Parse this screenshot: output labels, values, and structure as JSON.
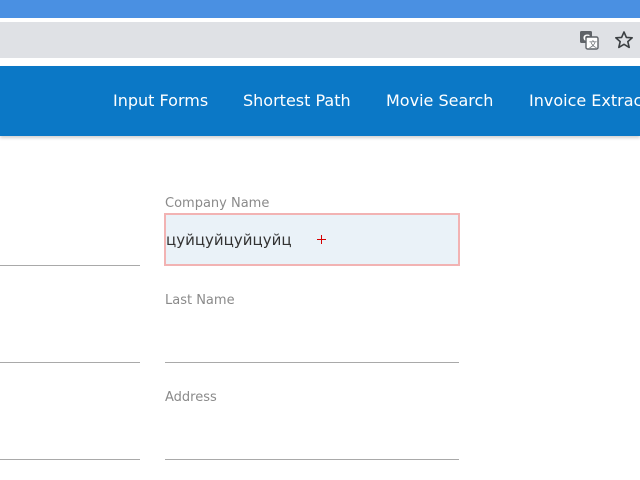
{
  "browser": {
    "translate_icon": "translate-icon",
    "bookmark_icon": "star-icon"
  },
  "nav": {
    "links": [
      {
        "label": "Input Forms"
      },
      {
        "label": "Shortest Path"
      },
      {
        "label": "Movie Search"
      },
      {
        "label": "Invoice Extrac"
      }
    ]
  },
  "form": {
    "company_name": {
      "label": "Company Name",
      "value": "цуйцуйцуйцуйц"
    },
    "last_name": {
      "label": "Last Name",
      "value": ""
    },
    "address": {
      "label": "Address",
      "value": ""
    }
  },
  "colors": {
    "nav_bg": "#0b78c6",
    "titlebar": "#4a90e2",
    "focus_border": "#f2b3b3",
    "input_bg": "#eaf2f8"
  }
}
